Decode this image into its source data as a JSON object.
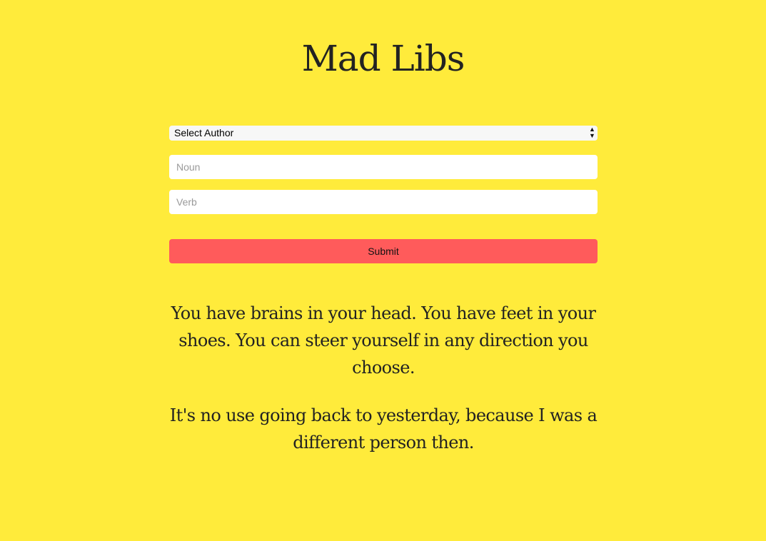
{
  "app": {
    "title": "Mad Libs"
  },
  "form": {
    "author_select": {
      "selected": "Select Author"
    },
    "noun": {
      "placeholder": "Noun",
      "value": ""
    },
    "verb": {
      "placeholder": "Verb",
      "value": ""
    },
    "submit_label": "Submit"
  },
  "quotes": [
    "You have brains in your head. You have feet in your shoes. You can steer yourself in any direction you choose.",
    "It's no use going back to yesterday, because I was a different person then."
  ],
  "icons": {
    "select_arrows": "up-down-arrows-icon"
  },
  "colors": {
    "background": "#ffeb3b",
    "submit_button": "#ff5b5b",
    "text": "#222222"
  }
}
